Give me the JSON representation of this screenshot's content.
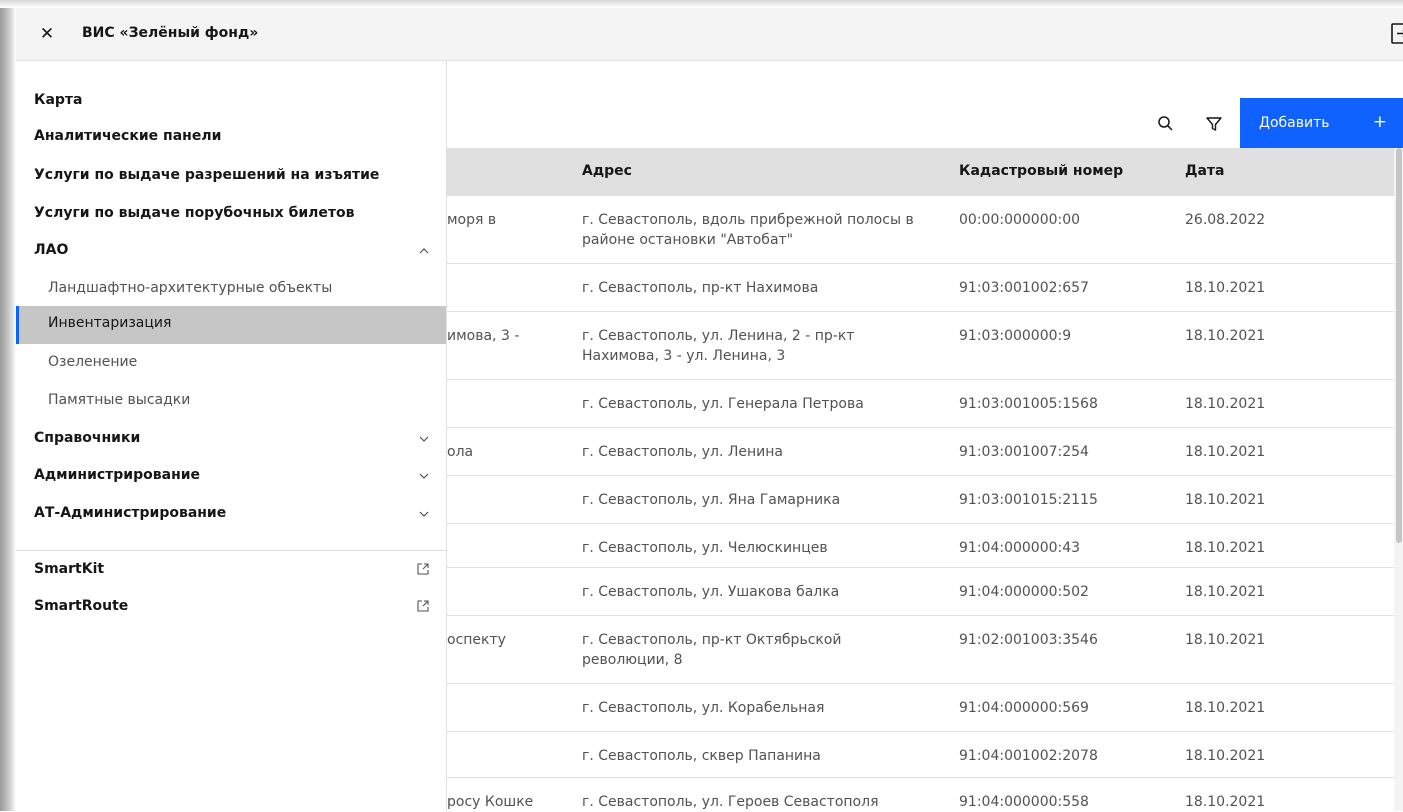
{
  "header": {
    "title": "ВИС «Зелёный фонд»",
    "close_icon": "close-icon",
    "logout_icon": "logout-icon"
  },
  "toolbar": {
    "add_label": "Добавить",
    "add_plus": "+",
    "search_icon": "search-icon",
    "filter_icon": "filter-icon"
  },
  "colors": {
    "accent": "#0f62fe",
    "header_bg": "#f4f4f4",
    "table_head_bg": "#e0e0e0",
    "active_item_bg": "#c6c6c6"
  },
  "table": {
    "columns": [
      "Адрес",
      "Кадастровый номер",
      "Дата"
    ],
    "rows": [
      {
        "partial": "моря в",
        "address": "г. Севастополь, вдоль прибрежной полосы в районе остановки \"Автобат\"",
        "cadastral": "00:00:000000:00",
        "date": "26.08.2022"
      },
      {
        "partial": "",
        "address": "г. Севастополь, пр-кт Нахимова",
        "cadastral": "91:03:001002:657",
        "date": "18.10.2021"
      },
      {
        "partial": "имова, 3 -",
        "address": "г. Севастополь, ул. Ленина, 2 - пр-кт Нахимова, 3 - ул. Ленина, 3",
        "cadastral": "91:03:000000:9",
        "date": "18.10.2021"
      },
      {
        "partial": "",
        "address": "г. Севастополь, ул. Генерала Петрова",
        "cadastral": "91:03:001005:1568",
        "date": "18.10.2021"
      },
      {
        "partial": "ола",
        "address": "г. Севастополь, ул. Ленина",
        "cadastral": "91:03:001007:254",
        "date": "18.10.2021"
      },
      {
        "partial": "",
        "address": "г. Севастополь, ул. Яна Гамарника",
        "cadastral": "91:03:001015:2115",
        "date": "18.10.2021"
      },
      {
        "partial": "",
        "address": "г. Севастополь, ул. Челюскинцев",
        "cadastral": "91:04:000000:43",
        "date": "18.10.2021"
      },
      {
        "partial": "",
        "address": "г. Севастополь, ул. Ушакова балка",
        "cadastral": "91:04:000000:502",
        "date": "18.10.2021"
      },
      {
        "partial": "оспекту",
        "address": "г. Севастополь, пр-кт Октябрьской революции, 8",
        "cadastral": "91:02:001003:3546",
        "date": "18.10.2021"
      },
      {
        "partial": "",
        "address": "г. Севастополь, ул. Корабельная",
        "cadastral": "91:04:000000:569",
        "date": "18.10.2021"
      },
      {
        "partial": "",
        "address": "г. Севастополь, сквер Папанина",
        "cadastral": "91:04:001002:2078",
        "date": "18.10.2021"
      },
      {
        "partial": "росу Кошке",
        "address": "г. Севастополь, ул. Героев Севастополя",
        "cadastral": "91:04:000000:558",
        "date": "18.10.2021"
      }
    ]
  },
  "sidebar": {
    "items": [
      {
        "label": "Карта"
      },
      {
        "label": "Аналитические панели"
      },
      {
        "label": "Услуги по выдаче разрешений на изъятие"
      },
      {
        "label": "Услуги по выдаче порубочных билетов"
      },
      {
        "label": "ЛАО",
        "icon": "chevron-up-icon"
      },
      {
        "label": "Ландшафтно-архитектурные объекты"
      },
      {
        "label": "Инвентаризация",
        "active": true
      },
      {
        "label": "Озеленение"
      },
      {
        "label": "Памятные высадки"
      },
      {
        "label": "Справочники",
        "icon": "chevron-down-icon"
      },
      {
        "label": "Администрирование",
        "icon": "chevron-down-icon"
      },
      {
        "label": "АТ-Администрирование",
        "icon": "chevron-down-icon"
      },
      {
        "label": "SmartKit",
        "icon": "external-link-icon"
      },
      {
        "label": "SmartRoute",
        "icon": "external-link-icon"
      }
    ]
  }
}
